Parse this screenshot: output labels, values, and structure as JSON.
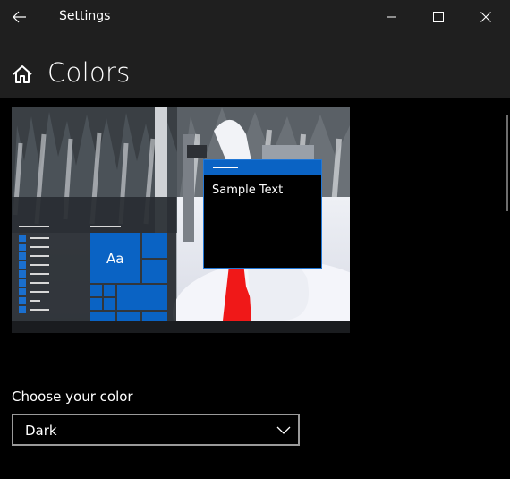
{
  "titlebar": {
    "title": "Settings",
    "back_icon": "back-arrow-icon",
    "minimize_icon": "minimize-icon",
    "maximize_icon": "maximize-icon",
    "close_icon": "close-icon"
  },
  "header": {
    "home_icon": "home-icon",
    "title": "Colors"
  },
  "preview": {
    "sample_text": "Sample Text",
    "tile_label": "Aa",
    "accent_color": "#0a63c4"
  },
  "color_setting": {
    "label": "Choose your color",
    "selected": "Dark",
    "chevron_icon": "chevron-down-icon"
  },
  "colors": {
    "background": "#000000",
    "chrome": "#1f1f1f",
    "accent": "#0a63c4"
  }
}
